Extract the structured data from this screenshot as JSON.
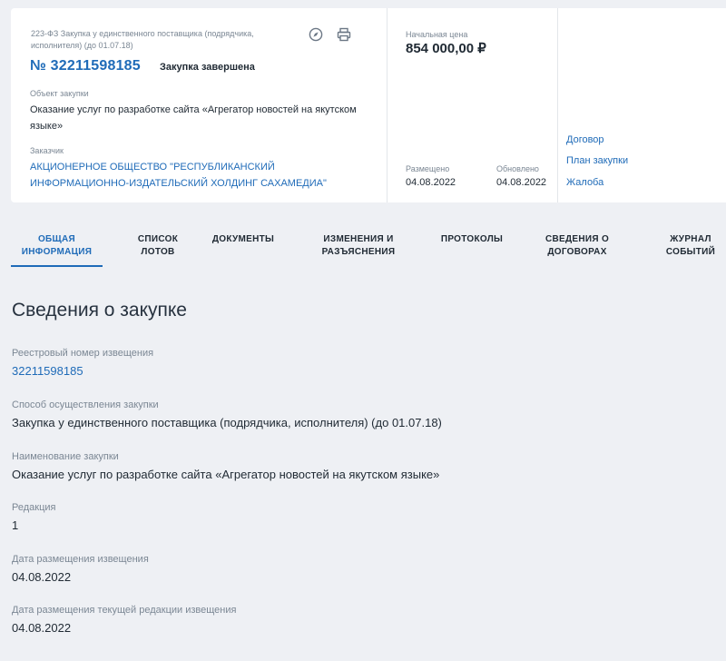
{
  "header_card": {
    "law_line": "223-ФЗ Закупка у единственного поставщика (подрядчика, исполнителя) (до 01.07.18)",
    "reg_number": "№ 32211598185",
    "status": "Закупка завершена",
    "object_label": "Объект закупки",
    "object_text": "Оказание услуг по разработке сайта «Агрегатор новостей на якутском языке»",
    "customer_label": "Заказчик",
    "customer_name": "АКЦИОНЕРНОЕ ОБЩЕСТВО \"РЕСПУБЛИКАНСКИЙ ИНФОРМАЦИОННО-ИЗДАТЕЛЬСКИЙ ХОЛДИНГ САХАМЕДИА\"",
    "price_label": "Начальная цена",
    "price": "854 000,00 ₽",
    "placed_label": "Размещено",
    "placed_date": "04.08.2022",
    "updated_label": "Обновлено",
    "updated_date": "04.08.2022",
    "icons": [
      "compass-icon",
      "print-icon"
    ]
  },
  "side_links": [
    "Договор",
    "План закупки",
    "Жалоба"
  ],
  "tabs": [
    {
      "line1": "ОБЩАЯ",
      "line2": "ИНФОРМАЦИЯ",
      "active": true
    },
    {
      "line1": "СПИСОК",
      "line2": "ЛОТОВ"
    },
    {
      "line1": "ДОКУМЕНТЫ",
      "line2": ""
    },
    {
      "line1": "ИЗМЕНЕНИЯ И",
      "line2": "РАЗЪЯСНЕНИЯ"
    },
    {
      "line1": "ПРОТОКОЛЫ",
      "line2": ""
    },
    {
      "line1": "СВЕДЕНИЯ О",
      "line2": "ДОГОВОРАХ"
    },
    {
      "line1": "ЖУРНАЛ",
      "line2": "СОБЫТИЙ"
    }
  ],
  "section": {
    "title": "Сведения о закупке",
    "fields": [
      {
        "label": "Реестровый номер извещения",
        "value": "32211598185"
      },
      {
        "label": "Способ осуществления закупки",
        "value": "Закупка у единственного поставщика (подрядчика, исполнителя) (до 01.07.18)"
      },
      {
        "label": "Наименование закупки",
        "value": "Оказание услуг по разработке сайта «Агрегатор новостей на якутском языке»"
      },
      {
        "label": "Редакция",
        "value": "1"
      },
      {
        "label": "Дата размещения извещения",
        "value": "04.08.2022"
      },
      {
        "label": "Дата размещения текущей редакции извещения",
        "value": "04.08.2022"
      }
    ]
  },
  "colors": {
    "accent": "#1f6bb8",
    "background": "#eef0f4",
    "muted": "#7b8794"
  }
}
